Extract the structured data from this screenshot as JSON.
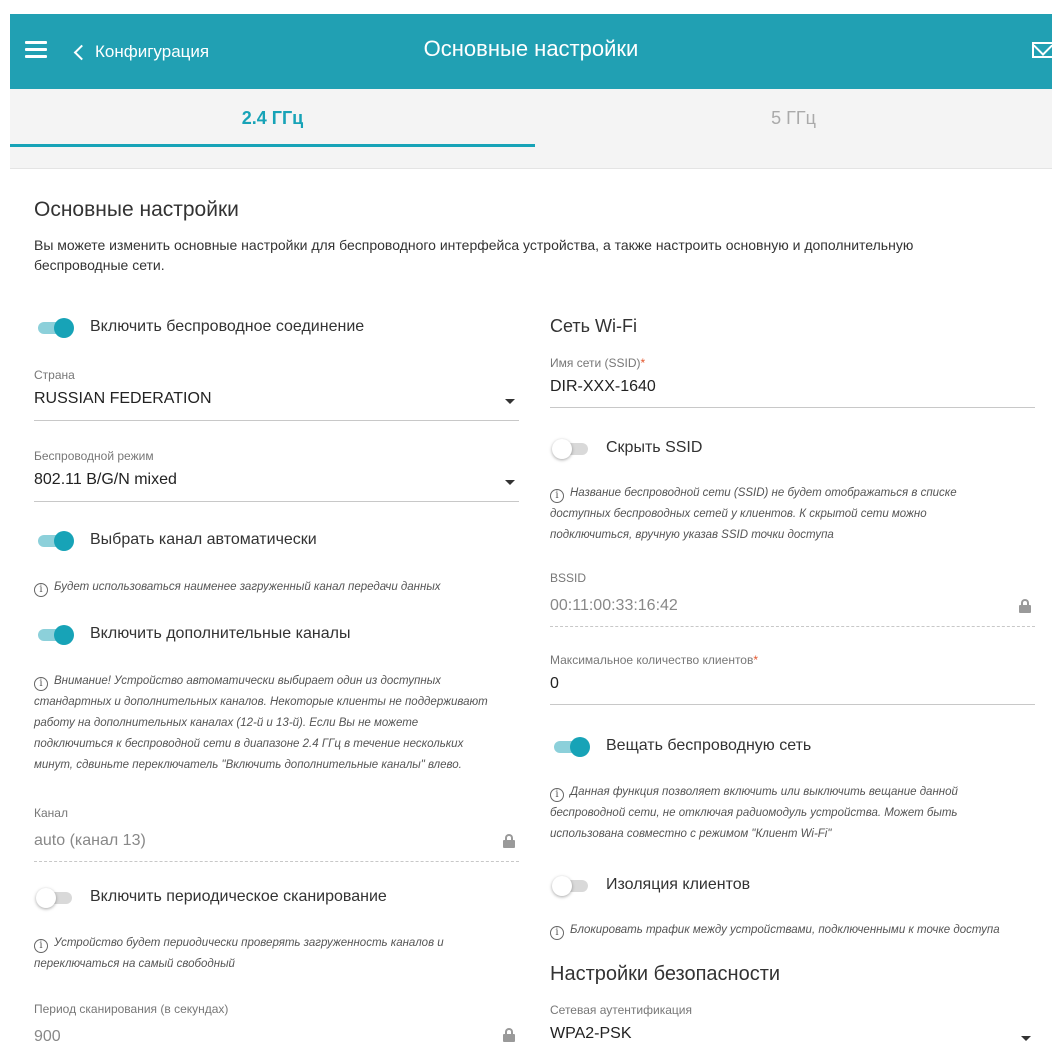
{
  "header": {
    "back_label": "Конфигурация",
    "title": "Основные настройки",
    "menu_icon": "hamburger-icon",
    "mail_icon": "mail-icon",
    "color": "#21a0b3"
  },
  "tabs": [
    {
      "label": "2.4 ГГц",
      "active": true
    },
    {
      "label": "5 ГГц",
      "active": false
    }
  ],
  "section": {
    "title": "Основные настройки",
    "description": "Вы можете изменить основные настройки для беспроводного интерфейса устройства, а также настроить основную и дополнительную беспроводные сети."
  },
  "left": {
    "enable_wireless": {
      "label": "Включить беспроводное соединение",
      "on": true
    },
    "country": {
      "label": "Страна",
      "value": "RUSSIAN FEDERATION"
    },
    "mode": {
      "label": "Беспроводной режим",
      "value": "802.11 B/G/N mixed"
    },
    "auto_channel": {
      "label": "Выбрать канал автоматически",
      "on": true,
      "hint": "Будет использоваться наименее загруженный канал передачи данных"
    },
    "extra_channels": {
      "label": "Включить дополнительные каналы",
      "on": true,
      "hint_lines": [
        "Внимание! Устройство автоматически выбирает один из доступных",
        "стандартных и дополнительных каналов. Некоторые клиенты не поддерживают",
        "работу на дополнительных каналах (12-й и 13-й). Если Вы не можете",
        "подключиться к беспроводной сети в диапазоне 2.4 ГГц в течение нескольких",
        "минут, сдвиньте переключатель \"Включить дополнительные каналы\" влево."
      ]
    },
    "channel": {
      "label": "Канал",
      "value": "auto (канал 13)"
    },
    "periodic_scan": {
      "label": "Включить периодическое сканирование",
      "on": false,
      "hint_lines": [
        "Устройство будет периодически проверять загруженность каналов и",
        "переключаться на самый свободный"
      ]
    },
    "scan_period": {
      "label": "Период сканирования (в секундах)",
      "value": "900"
    }
  },
  "right": {
    "wifi_title": "Сеть Wi-Fi",
    "ssid": {
      "label": "Имя сети (SSID)",
      "required": "*",
      "value": "DIR-XXX-1640"
    },
    "hide_ssid": {
      "label": "Скрыть SSID",
      "on": false,
      "hint_lines": [
        "Название беспроводной сети (SSID) не будет отображаться в списке",
        "доступных беспроводных сетей у клиентов. К скрытой сети можно",
        "подключиться, вручную указав SSID точки доступа"
      ]
    },
    "bssid": {
      "label": "BSSID",
      "value": "00:11:00:33:16:42"
    },
    "max_clients": {
      "label": "Максимальное количество клиентов",
      "required": "*",
      "value": "0"
    },
    "broadcast": {
      "label": "Вещать беспроводную сеть",
      "on": true,
      "hint_lines": [
        "Данная функция позволяет включить или выключить вещание данной",
        "беспроводной сети, не отключая радиомодуль устройства. Может быть",
        "использована совместно с режимом \"Клиент Wi-Fi\""
      ]
    },
    "isolation": {
      "label": "Изоляция клиентов",
      "on": false,
      "hint": "Блокировать трафик между устройствами, подключенными к точке доступа"
    },
    "security_title": "Настройки безопасности",
    "auth": {
      "label": "Сетевая аутентификация",
      "value": "WPA2-PSK"
    }
  }
}
